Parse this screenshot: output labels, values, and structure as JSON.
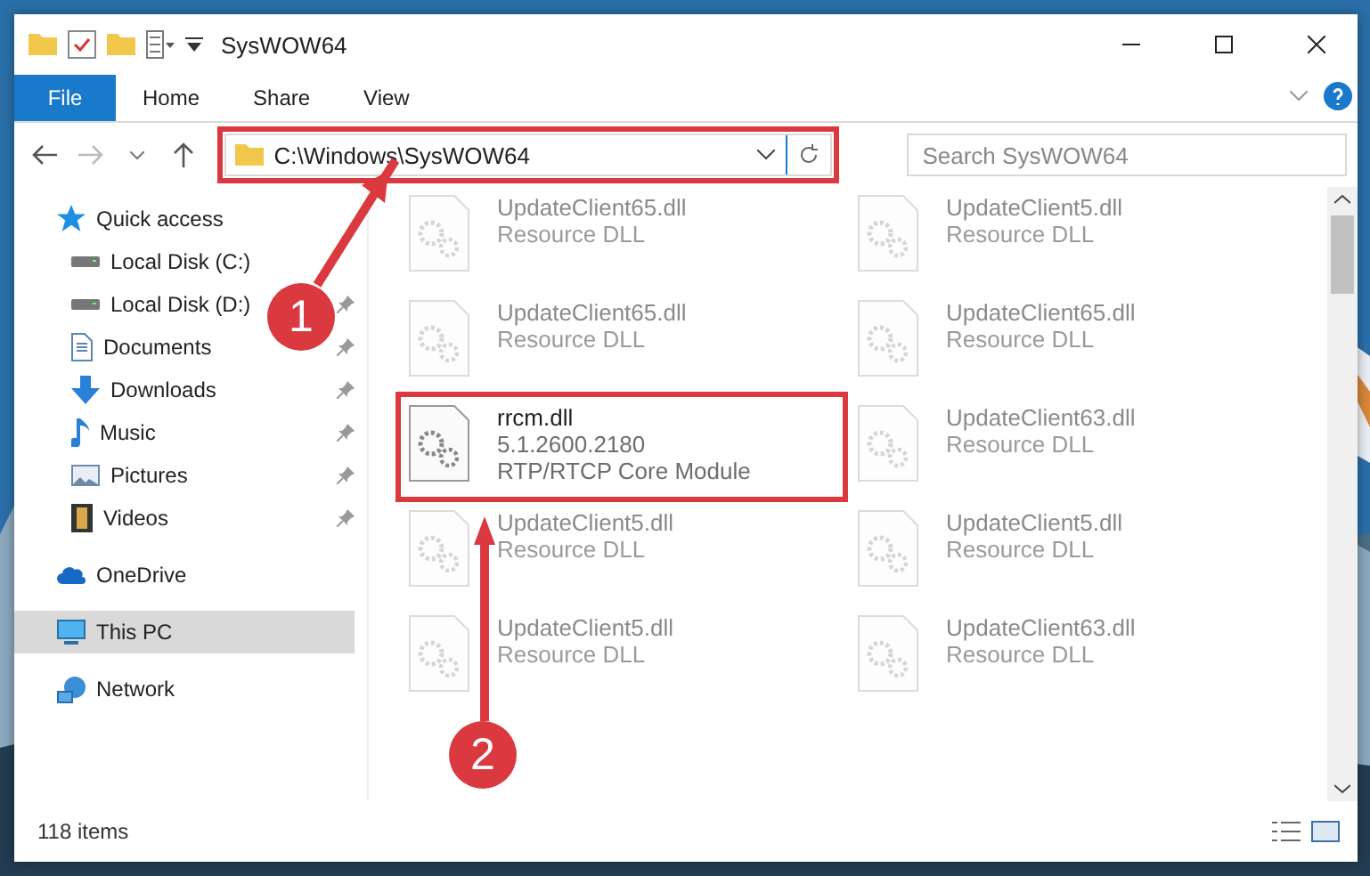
{
  "window": {
    "title": "SysWOW64"
  },
  "ribbon_tabs": [
    {
      "label": "File",
      "selected": true
    },
    {
      "label": "Home",
      "selected": false
    },
    {
      "label": "Share",
      "selected": false
    },
    {
      "label": "View",
      "selected": false
    }
  ],
  "address": {
    "path": "C:\\Windows\\SysWOW64",
    "highlight": true
  },
  "search": {
    "placeholder": "Search SysWOW64"
  },
  "sidebar": {
    "items": [
      {
        "label": "Quick access",
        "kind": "star",
        "pinned": false,
        "selected": false,
        "children": [
          {
            "label": "Local Disk (C:)",
            "kind": "drive",
            "pinned": false,
            "selected": false
          },
          {
            "label": "Local Disk (D:)",
            "kind": "drive",
            "pinned": true,
            "selected": false
          },
          {
            "label": "Documents",
            "kind": "document",
            "pinned": true,
            "selected": false
          },
          {
            "label": "Downloads",
            "kind": "download",
            "pinned": true,
            "selected": false
          },
          {
            "label": "Music",
            "kind": "music",
            "pinned": true,
            "selected": false
          },
          {
            "label": "Pictures",
            "kind": "pictures",
            "pinned": true,
            "selected": false
          },
          {
            "label": "Videos",
            "kind": "videos",
            "pinned": true,
            "selected": false
          }
        ]
      },
      {
        "label": "OneDrive",
        "kind": "cloud",
        "pinned": false,
        "selected": false
      },
      {
        "label": "This PC",
        "kind": "pc",
        "pinned": false,
        "selected": true
      },
      {
        "label": "Network",
        "kind": "network",
        "pinned": false,
        "selected": false
      }
    ]
  },
  "files": [
    {
      "name": "UpdateClient65.dll",
      "lines": [
        "Resource DLL"
      ],
      "dimmed": true,
      "highlight": false
    },
    {
      "name": "UpdateClient5.dll",
      "lines": [
        "Resource DLL"
      ],
      "dimmed": true,
      "highlight": false
    },
    {
      "name": "UpdateClient65.dll",
      "lines": [
        "Resource DLL"
      ],
      "dimmed": true,
      "highlight": false
    },
    {
      "name": "UpdateClient65.dll",
      "lines": [
        "Resource DLL"
      ],
      "dimmed": true,
      "highlight": false
    },
    {
      "name": "rrcm.dll",
      "lines": [
        "5.1.2600.2180",
        "RTP/RTCP Core Module"
      ],
      "dimmed": false,
      "highlight": true
    },
    {
      "name": "UpdateClient63.dll",
      "lines": [
        "Resource DLL"
      ],
      "dimmed": true,
      "highlight": false
    },
    {
      "name": "UpdateClient5.dll",
      "lines": [
        "Resource DLL"
      ],
      "dimmed": true,
      "highlight": false
    },
    {
      "name": "UpdateClient5.dll",
      "lines": [
        "Resource DLL"
      ],
      "dimmed": true,
      "highlight": false
    },
    {
      "name": "UpdateClient5.dll",
      "lines": [
        "Resource DLL"
      ],
      "dimmed": true,
      "highlight": false
    },
    {
      "name": "UpdateClient63.dll",
      "lines": [
        "Resource DLL"
      ],
      "dimmed": true,
      "highlight": false
    }
  ],
  "annotations": [
    {
      "number": "1"
    },
    {
      "number": "2"
    }
  ],
  "status_bar": {
    "count": "118 items"
  }
}
